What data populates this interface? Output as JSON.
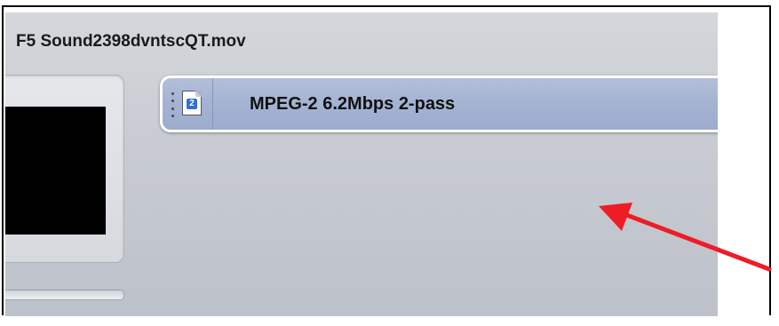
{
  "window": {
    "file_name": "F5 Sound2398dvntscQT.mov"
  },
  "target": {
    "icon": "mpeg2-document-icon",
    "icon_badge": "2",
    "preset_label": "MPEG-2 6.2Mbps 2-pass"
  },
  "annotation": {
    "arrow_color": "#ee1c25"
  },
  "colors": {
    "panel_bg": "#c9ccd3",
    "row_selected": "#a4b3d2"
  }
}
